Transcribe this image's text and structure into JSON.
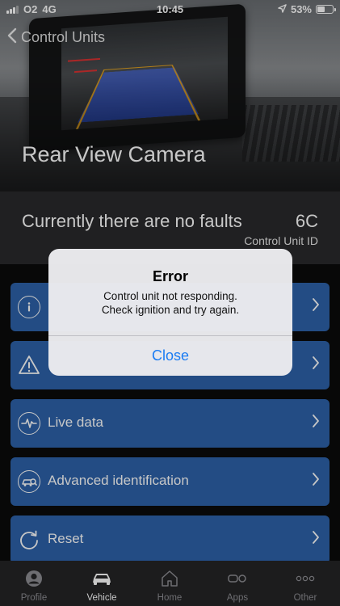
{
  "status_bar": {
    "carrier": "O2",
    "network": "4G",
    "time": "10:45",
    "battery": "53%",
    "battery_level": 0.53
  },
  "nav": {
    "back_label": "Control Units"
  },
  "hero": {
    "title": "Rear View Camera"
  },
  "fault_bar": {
    "message": "Currently there are no faults",
    "code": "6C",
    "code_label": "Control Unit ID"
  },
  "menu": {
    "items": [
      {
        "label": "",
        "icon": "info-icon"
      },
      {
        "label": "",
        "icon": "warning-icon"
      },
      {
        "label": "Live data",
        "icon": "pulse-icon"
      },
      {
        "label": "Advanced identification",
        "icon": "search-car-icon"
      },
      {
        "label": "Reset",
        "icon": "reset-icon"
      }
    ]
  },
  "alert": {
    "title": "Error",
    "line1": "Control unit not responding.",
    "line2": "Check ignition and try again.",
    "button": "Close"
  },
  "tabbar": {
    "tabs": [
      {
        "label": "Profile",
        "icon": "person-icon"
      },
      {
        "label": "Vehicle",
        "icon": "car-icon",
        "active": true
      },
      {
        "label": "Home",
        "icon": "home-icon"
      },
      {
        "label": "Apps",
        "icon": "apps-icon"
      },
      {
        "label": "Other",
        "icon": "more-icon"
      }
    ]
  },
  "colors": {
    "menu_item": "#2d62a9",
    "alert_button": "#1a7cf3",
    "fault_bar": "#2a2a2c",
    "tabbar": "#242426"
  }
}
